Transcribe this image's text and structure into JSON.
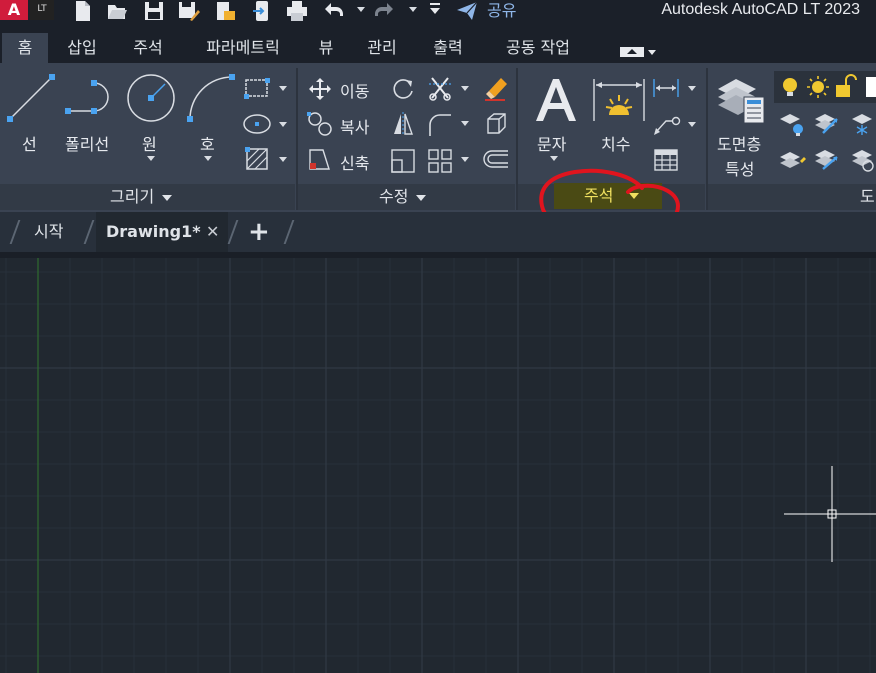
{
  "titlebar": {
    "logo_letter": "A",
    "logo_badge": "LT",
    "share_label": "공유",
    "title": "Autodesk AutoCAD LT 2023",
    "qat_icons": [
      "new-icon",
      "open-icon",
      "save-icon",
      "save-as-icon",
      "export-icon",
      "share-icon",
      "print-icon",
      "undo-icon",
      "redo-icon",
      "customize-icon"
    ]
  },
  "ribbon_tabs": [
    "홈",
    "삽입",
    "주석",
    "파라메트릭",
    "뷰",
    "관리",
    "출력",
    "공동 작업"
  ],
  "ribbon": {
    "draw": {
      "line": "선",
      "polyline": "폴리선",
      "circle": "원",
      "arc": "호",
      "footer": "그리기"
    },
    "modify": {
      "move": "이동",
      "copy": "복사",
      "stretch": "신축",
      "footer": "수정"
    },
    "annotation": {
      "text": "문자",
      "dimension": "치수",
      "footer": "주석"
    },
    "layers": {
      "properties_line1": "도면층",
      "properties_line2": "특성",
      "footer_partial": "도"
    }
  },
  "file_tabs": {
    "start": "시작",
    "drawing": "Drawing1*",
    "close_symbol": "✕",
    "add_symbol": "+"
  },
  "colors": {
    "accent_blue": "#4aa3f0",
    "highlight_yellow": "#f0e060",
    "annotation_circle": "#e0141e"
  }
}
